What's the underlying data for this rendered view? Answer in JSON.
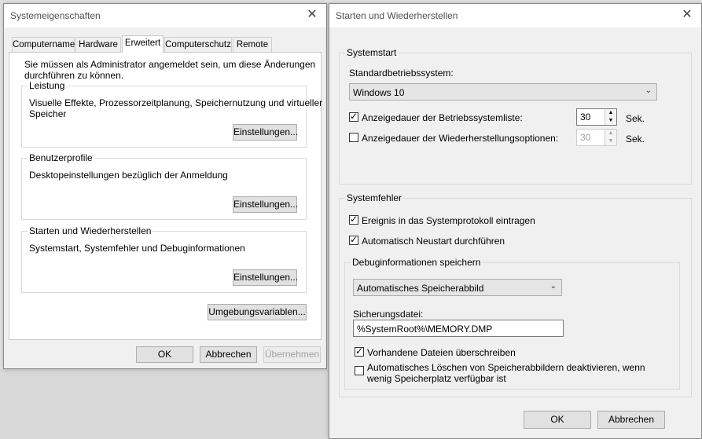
{
  "left_window": {
    "title": "Systemeigenschaften",
    "close": "✕",
    "tabs": [
      "Computername",
      "Hardware",
      "Erweitert",
      "Computerschutz",
      "Remote"
    ],
    "admin_note_line1": "Sie müssen als Administrator angemeldet sein, um diese Änderungen",
    "admin_note_line2": "durchführen zu können.",
    "performance": {
      "label": "Leistung",
      "desc_line1": "Visuelle Effekte, Prozessorzeitplanung, Speichernutzung und virtueller",
      "desc_line2": "Speicher",
      "button": "Einstellungen..."
    },
    "profiles": {
      "label": "Benutzerprofile",
      "desc": "Desktopeinstellungen bezüglich der Anmeldung",
      "button": "Einstellungen..."
    },
    "startup": {
      "label": "Starten und Wiederherstellen",
      "desc": "Systemstart, Systemfehler und Debuginformationen",
      "button": "Einstellungen..."
    },
    "env_button": "Umgebungsvariablen...",
    "ok": "OK",
    "cancel": "Abbrechen",
    "apply": "Übernehmen"
  },
  "right_window": {
    "title": "Starten und Wiederherstellen",
    "close": "✕",
    "systemstart": {
      "label": "Systemstart",
      "default_os_label": "Standardbetriebssystem:",
      "default_os_value": "Windows 10",
      "show_os_list_label": "Anzeigedauer der Betriebssystemliste:",
      "show_os_list_checked": true,
      "show_os_list_value": "30",
      "show_recovery_label": "Anzeigedauer der Wiederherstellungsoptionen:",
      "show_recovery_checked": false,
      "show_recovery_value": "30",
      "unit": "Sek."
    },
    "systemfehler": {
      "label": "Systemfehler",
      "log_event_label": "Ereignis in das Systemprotokoll eintragen",
      "log_event_checked": true,
      "auto_restart_label": "Automatisch Neustart durchführen",
      "auto_restart_checked": true
    },
    "debug": {
      "label": "Debuginformationen speichern",
      "dump_type": "Automatisches Speicherabbild",
      "dump_file_label": "Sicherungsdatei:",
      "dump_file_value": "%SystemRoot%\\MEMORY.DMP",
      "overwrite_label": "Vorhandene Dateien überschreiben",
      "overwrite_checked": true,
      "disable_auto_delete_line1": "Automatisches Löschen von Speicherabbildern deaktivieren, wenn",
      "disable_auto_delete_line2": "wenig Speicherplatz verfügbar ist",
      "disable_auto_delete_checked": false
    },
    "ok": "OK",
    "cancel": "Abbrechen"
  },
  "check_glyph": "✓",
  "arrow_down": "⌄",
  "spin_up": "▲",
  "spin_down": "▼"
}
